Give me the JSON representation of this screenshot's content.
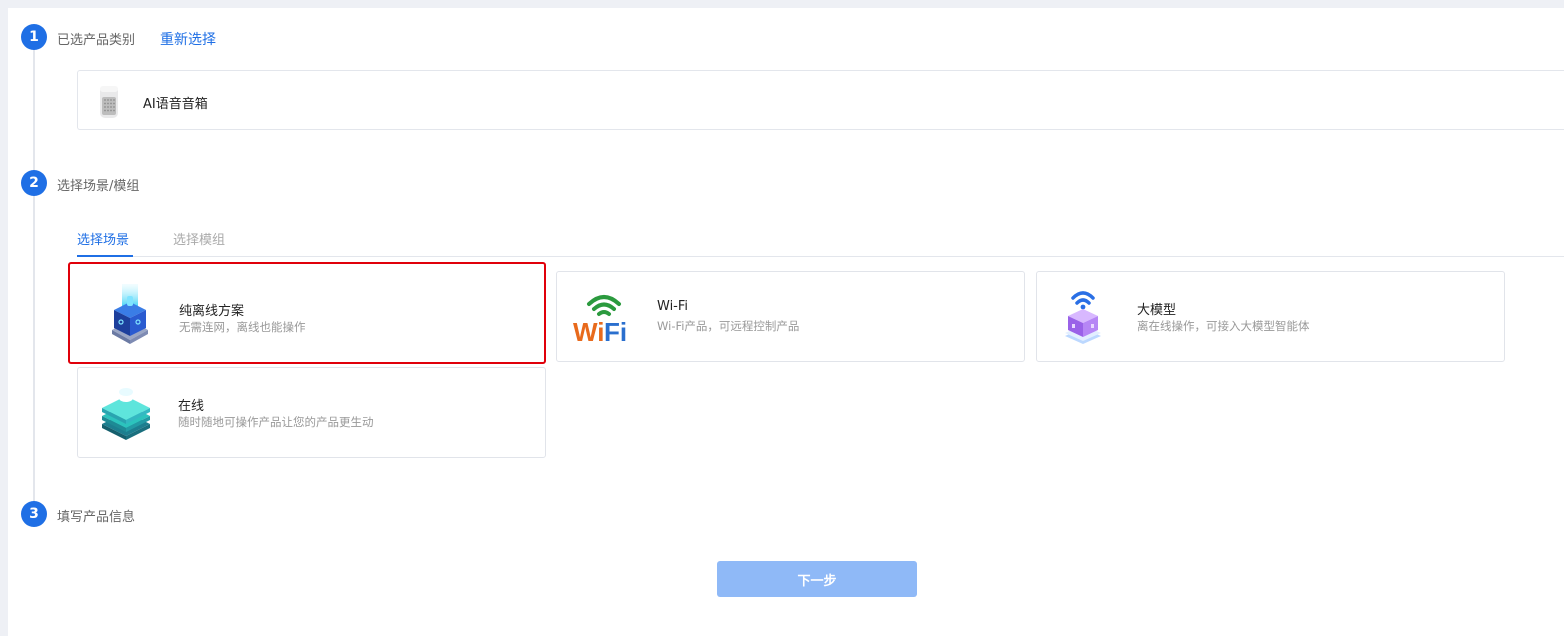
{
  "steps": [
    {
      "number": "1",
      "title": "已选产品类别",
      "action": "重新选择"
    },
    {
      "number": "2",
      "title": "选择场景/模组"
    },
    {
      "number": "3",
      "title": "填写产品信息"
    }
  ],
  "selected_product": {
    "name": "AI语音音箱",
    "icon": "smart-speaker-icon"
  },
  "tabs": [
    {
      "label": "选择场景",
      "active": true
    },
    {
      "label": "选择模组",
      "active": false
    }
  ],
  "scenarios": [
    {
      "title": "纯离线方案",
      "desc": "无需连网，离线也能操作",
      "icon": "offline-cube-icon",
      "selected": true
    },
    {
      "title": "Wi-Fi",
      "desc": "Wi-Fi产品，可远程控制产品",
      "icon": "wifi-logo-icon",
      "selected": false
    },
    {
      "title": "大模型",
      "desc": "离在线操作，可接入大模型智能体",
      "icon": "ai-model-cube-icon",
      "selected": false
    },
    {
      "title": "在线",
      "desc": "随时随地可操作产品让您的产品更生动",
      "icon": "online-stack-icon",
      "selected": false
    }
  ],
  "next_button": {
    "label": "下一步"
  },
  "colors": {
    "accent": "#1f6fe5",
    "selection_border": "#e0000a",
    "button_disabled": "#8fb9f7"
  }
}
